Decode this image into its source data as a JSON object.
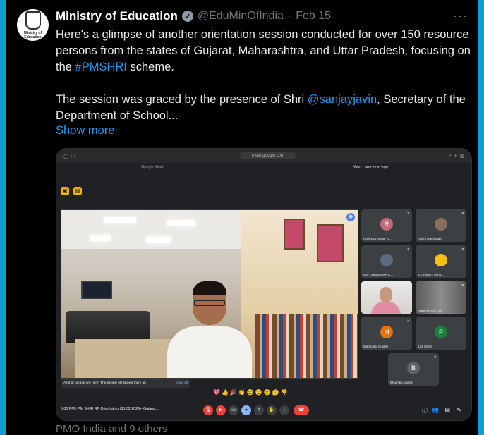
{
  "tweet": {
    "author_name": "Ministry of Education",
    "handle": "@EduMinOfIndia",
    "separator": "·",
    "date": "Feb 15",
    "more_icon": "more-horizontal-icon",
    "verified_icon": "verified-badge-icon",
    "avatar_text": "Ministry of Education",
    "text_p1_a": "Here's a glimpse of another orientation session conducted for over 150 resource persons from the states of Gujarat, Maharashtra, and Uttar Pradesh, focusing on the ",
    "hashtag": "#PMSHRI",
    "text_p1_b": " scheme.",
    "text_p2_a": "The session was graced by the presence of Shri ",
    "mention": "@sanjayjavin",
    "text_p2_b": ", Secretary of the Department of School...",
    "show_more": "Show more",
    "footer": "PMO India and 9 others"
  },
  "screenshot": {
    "url": "meet.google.com",
    "tab1": "Google Meet",
    "tab2": "Meet - ann-xxwr-xqo",
    "participants": [
      {
        "initial": "R",
        "name": "Ravindra kumar K...",
        "color": "#c26a76"
      },
      {
        "initial": "",
        "name": "Rahul Machkade",
        "color": "#3c4043"
      },
      {
        "initial": "",
        "name": "IAS CHANDERR K...",
        "color": "#3c4043"
      },
      {
        "initial": "",
        "name": "J.K Pimary Schu...",
        "color": "#f4c20d"
      },
      {
        "initial": "",
        "name": "",
        "color": ""
      },
      {
        "initial": "",
        "name": "ABHAYA CHITLA",
        "color": ""
      },
      {
        "initial": "M",
        "name": "Madhukar Kushte",
        "color": "#e8710a"
      },
      {
        "initial": "P",
        "name": "133 others",
        "color": "#188038"
      },
      {
        "initial": "B",
        "name": "Bhumika Anand",
        "color": "#5f6368"
      }
    ],
    "toast_text": "A lot of people are here. The people list shows them all.",
    "toast_action": "View all",
    "reactions": "💖👍🎉👏😂😮😢🤔👎",
    "meeting_info": "5:00 PM | PM SHRI RP Orientation (15.02.2024)- Gujarat,..."
  }
}
